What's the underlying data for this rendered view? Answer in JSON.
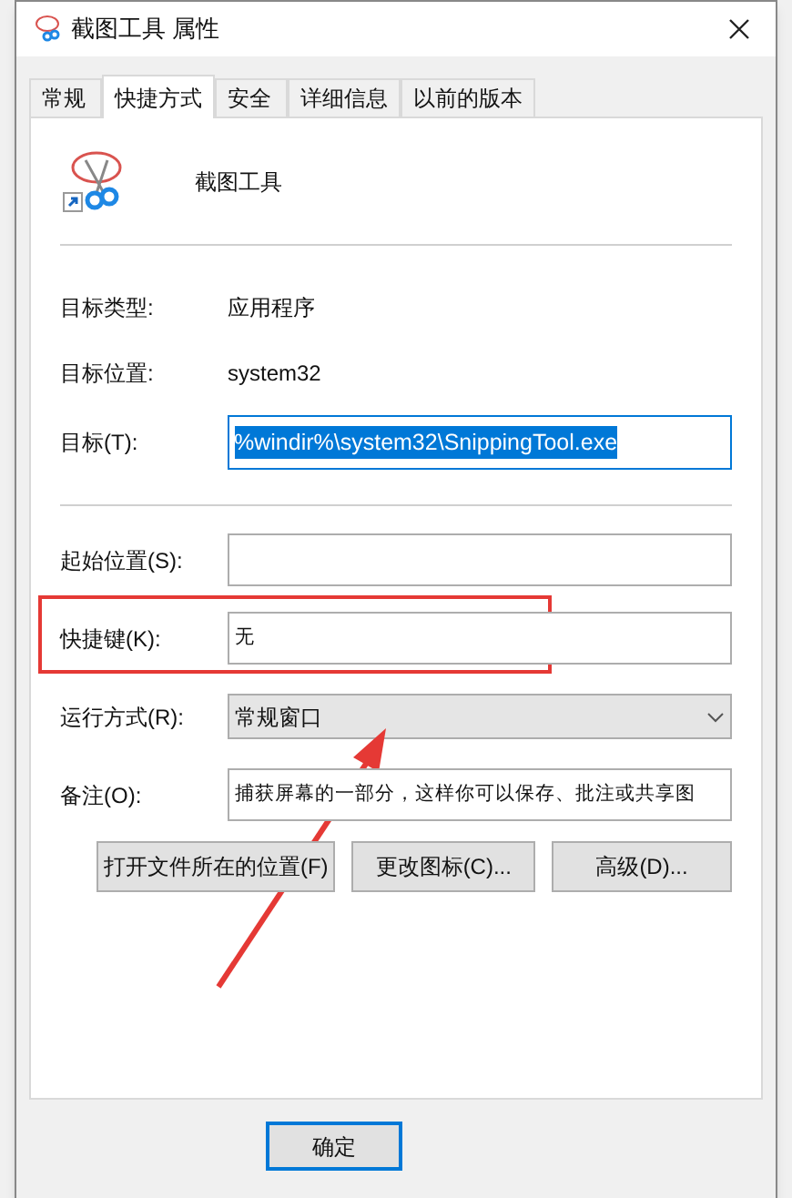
{
  "window": {
    "title": "截图工具 属性"
  },
  "tabs": [
    {
      "label": "常规",
      "selected": false
    },
    {
      "label": "快捷方式",
      "selected": true
    },
    {
      "label": "安全",
      "selected": false
    },
    {
      "label": "详细信息",
      "selected": false
    },
    {
      "label": "以前的版本",
      "selected": false
    }
  ],
  "app_name": "截图工具",
  "info_rows": [
    {
      "label": "目标类型:",
      "value": "应用程序"
    },
    {
      "label": "目标位置:",
      "value": "system32"
    }
  ],
  "target": {
    "label": "目标(T):",
    "value": "%windir%\\system32\\SnippingTool.exe",
    "selected": true
  },
  "fields": [
    {
      "kind": "input",
      "label": "起始位置(S):"
    },
    {
      "kind": "input",
      "label": "快捷键(K):",
      "value": "无"
    },
    {
      "kind": "dropdown",
      "label": "运行方式(R):",
      "value": "常规窗口"
    },
    {
      "kind": "input",
      "label": "备注(O):",
      "value": "捕获屏幕的一部分，这样你可以保存、批注或共享图"
    }
  ],
  "buttons": [
    "打开文件所在的位置(F)",
    "更改图标(C)...",
    "高级(D)..."
  ],
  "footer_buttons": [
    "确定"
  ]
}
